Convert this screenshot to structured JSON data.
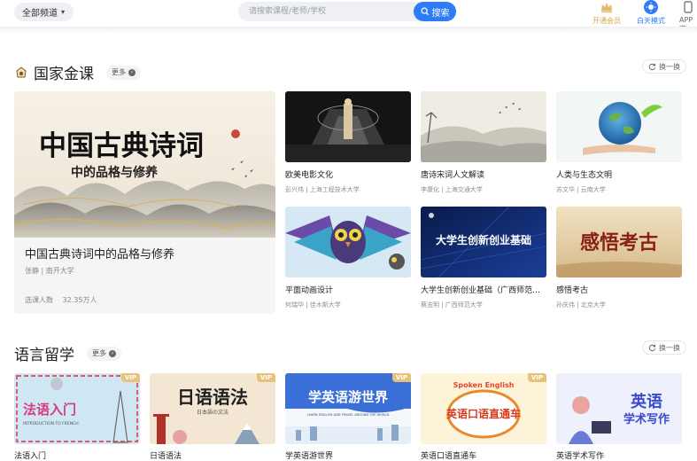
{
  "header": {
    "channel_label": "全部频道",
    "search_placeholder": "请搜索课程/老师/学校",
    "search_button": "搜索",
    "vip_label": "开通会员",
    "daymode_label": "白天模式",
    "app_label": "APP下"
  },
  "sections": {
    "national": {
      "title": "国家金课",
      "more": "更多",
      "swap": "换一换",
      "featured": {
        "image_text_main": "中国古典诗词",
        "image_text_sub": "中的品格与修养",
        "title": "中国古典诗词中的品格与修养",
        "teacher": "张静 | 南开大学",
        "enroll_label": "选课人数",
        "enroll_value": "32.35万人"
      },
      "courses": [
        {
          "title": "欧美电影文化",
          "teacher": "彭兴伟 | 上海工程技术大学"
        },
        {
          "title": "唐诗宋词人文解读",
          "teacher": "李康化 | 上海交通大学"
        },
        {
          "title": "人类与生态文明",
          "teacher": "苏文华 | 云南大学"
        },
        {
          "title": "平面动画设计",
          "teacher": "何瑞华 | 佳木斯大学"
        },
        {
          "title": "大学生创新创业基础（广西师范大学）",
          "teacher": "蔡志明 | 广西师范大学",
          "image_text": "大学生创新创业基础"
        },
        {
          "title": "感悟考古",
          "teacher": "孙庆伟 | 北京大学",
          "image_text": "感悟考古"
        }
      ]
    },
    "language": {
      "title": "语言留学",
      "more": "更多",
      "swap": "换一换",
      "vip_tag": "VIP",
      "courses": [
        {
          "title": "法语入门",
          "image_text": "法语入门",
          "image_sub": "INTRODUCTION TO FRENCH"
        },
        {
          "title": "日语语法",
          "image_text": "日语语法",
          "image_sub": "日本語の文法"
        },
        {
          "title": "学英语游世界",
          "image_text": "学英语游世界",
          "image_sub": "LEARN ENGLISH AND TRAVEL AROUND THE WORLD"
        },
        {
          "title": "英语口语直通车",
          "image_text": "英语口语直通车",
          "image_sub": "Spoken English"
        },
        {
          "title": "英语学术写作",
          "image_text": "英语学术写作"
        }
      ]
    }
  },
  "colors": {
    "accent": "#2e7cf6",
    "vip_gold": "#d9a64e"
  },
  "icons": {
    "search": "search-icon",
    "vip": "crown-icon",
    "daymode": "sun-icon",
    "app": "phone-icon",
    "refresh": "refresh-icon"
  }
}
